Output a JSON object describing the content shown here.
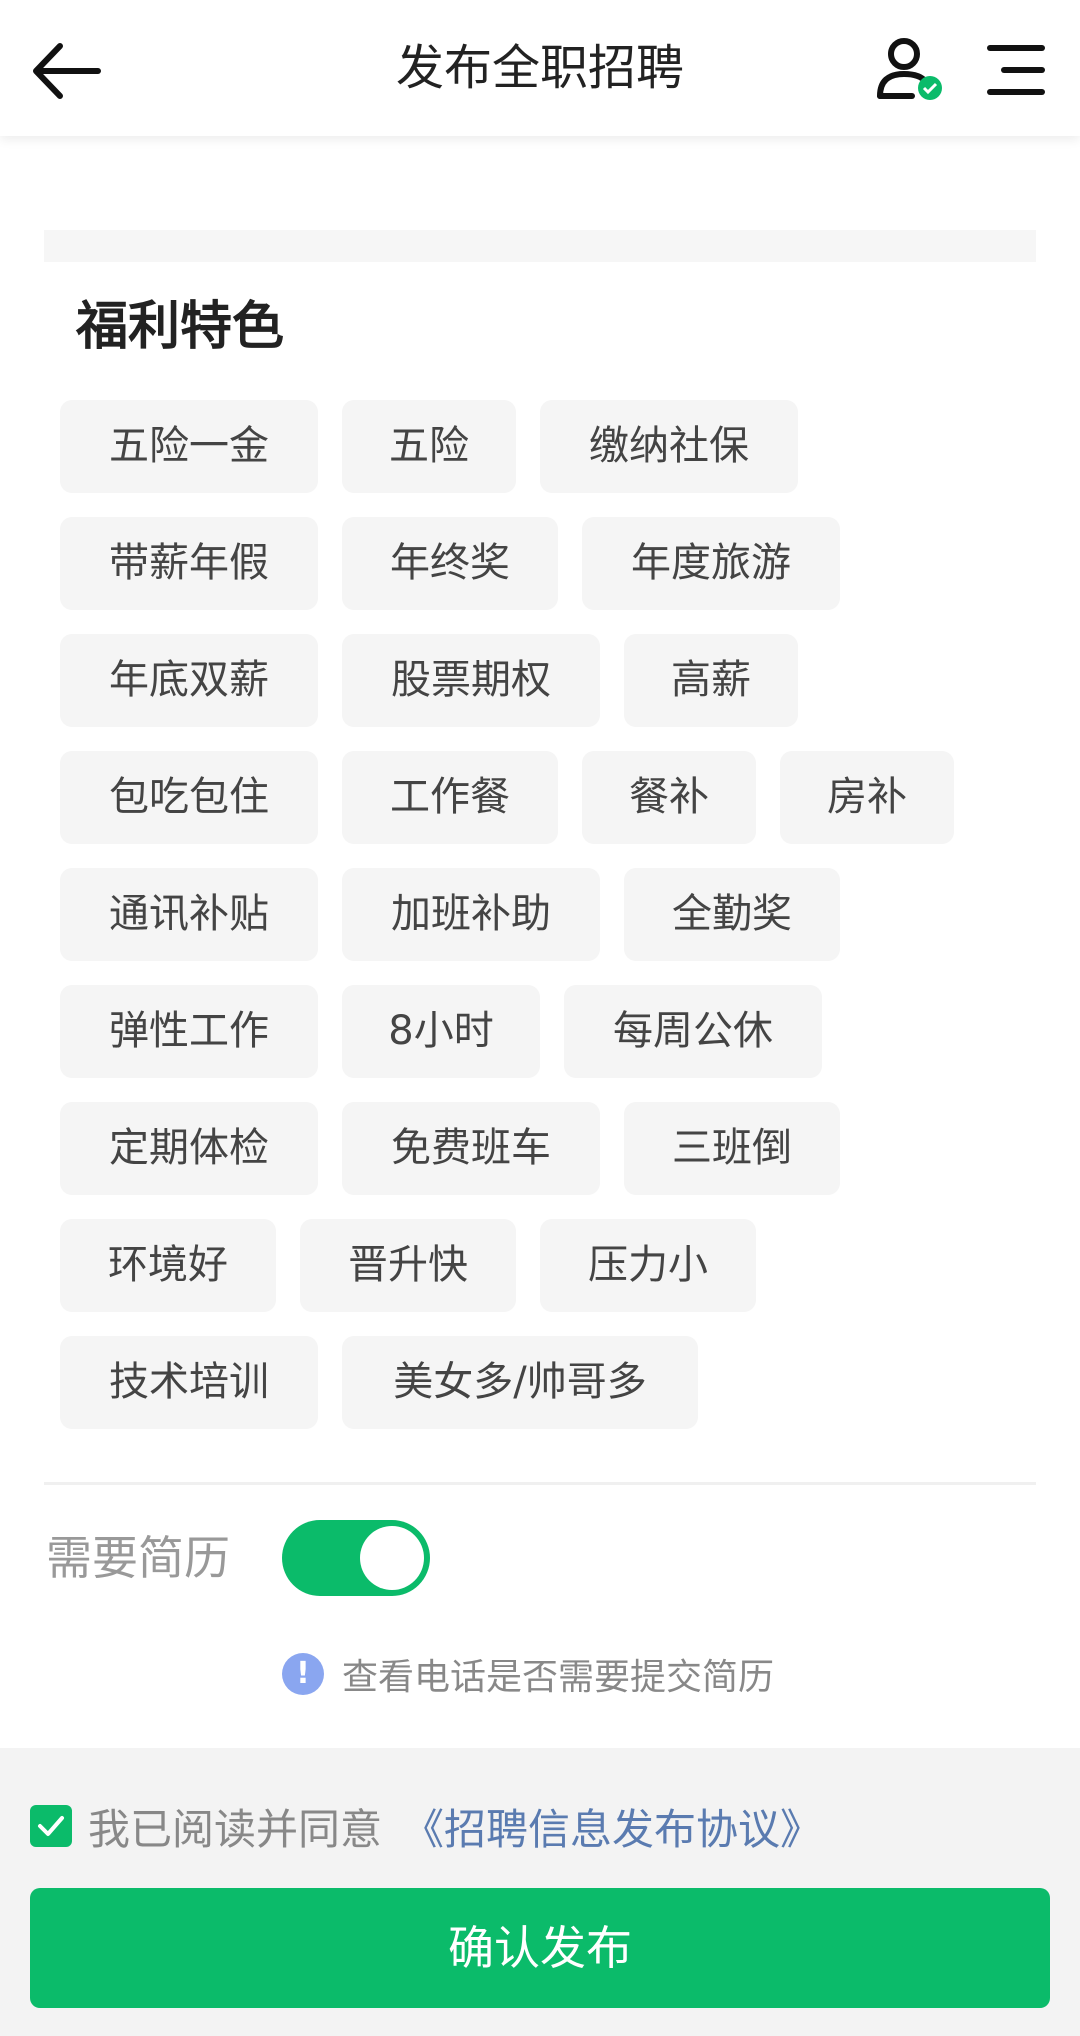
{
  "header": {
    "title": "发布全职招聘"
  },
  "benefits": {
    "title": "福利特色",
    "rows": [
      [
        "五险一金",
        "五险",
        "缴纳社保"
      ],
      [
        "带薪年假",
        "年终奖",
        "年度旅游"
      ],
      [
        "年底双薪",
        "股票期权",
        "高薪"
      ],
      [
        "包吃包住",
        "工作餐",
        "餐补",
        "房补"
      ],
      [
        "通讯补贴",
        "加班补助",
        "全勤奖"
      ],
      [
        "弹性工作",
        "8小时",
        "每周公休"
      ],
      [
        "定期体检",
        "免费班车",
        "三班倒"
      ],
      [
        "环境好",
        "晋升快",
        "压力小"
      ],
      [
        "技术培训",
        "美女多/帅哥多"
      ]
    ]
  },
  "resume": {
    "label": "需要简历",
    "toggle_on": true,
    "hint": "查看电话是否需要提交简历",
    "hint_icon": "!"
  },
  "footer": {
    "agree_checked": true,
    "agree_text": "我已阅读并同意",
    "agreement_link": "《招聘信息发布协议》",
    "confirm_label": "确认发布"
  },
  "colors": {
    "accent": "#0bbb6a",
    "link": "#5a7bb0",
    "info": "#8aa6f0"
  }
}
